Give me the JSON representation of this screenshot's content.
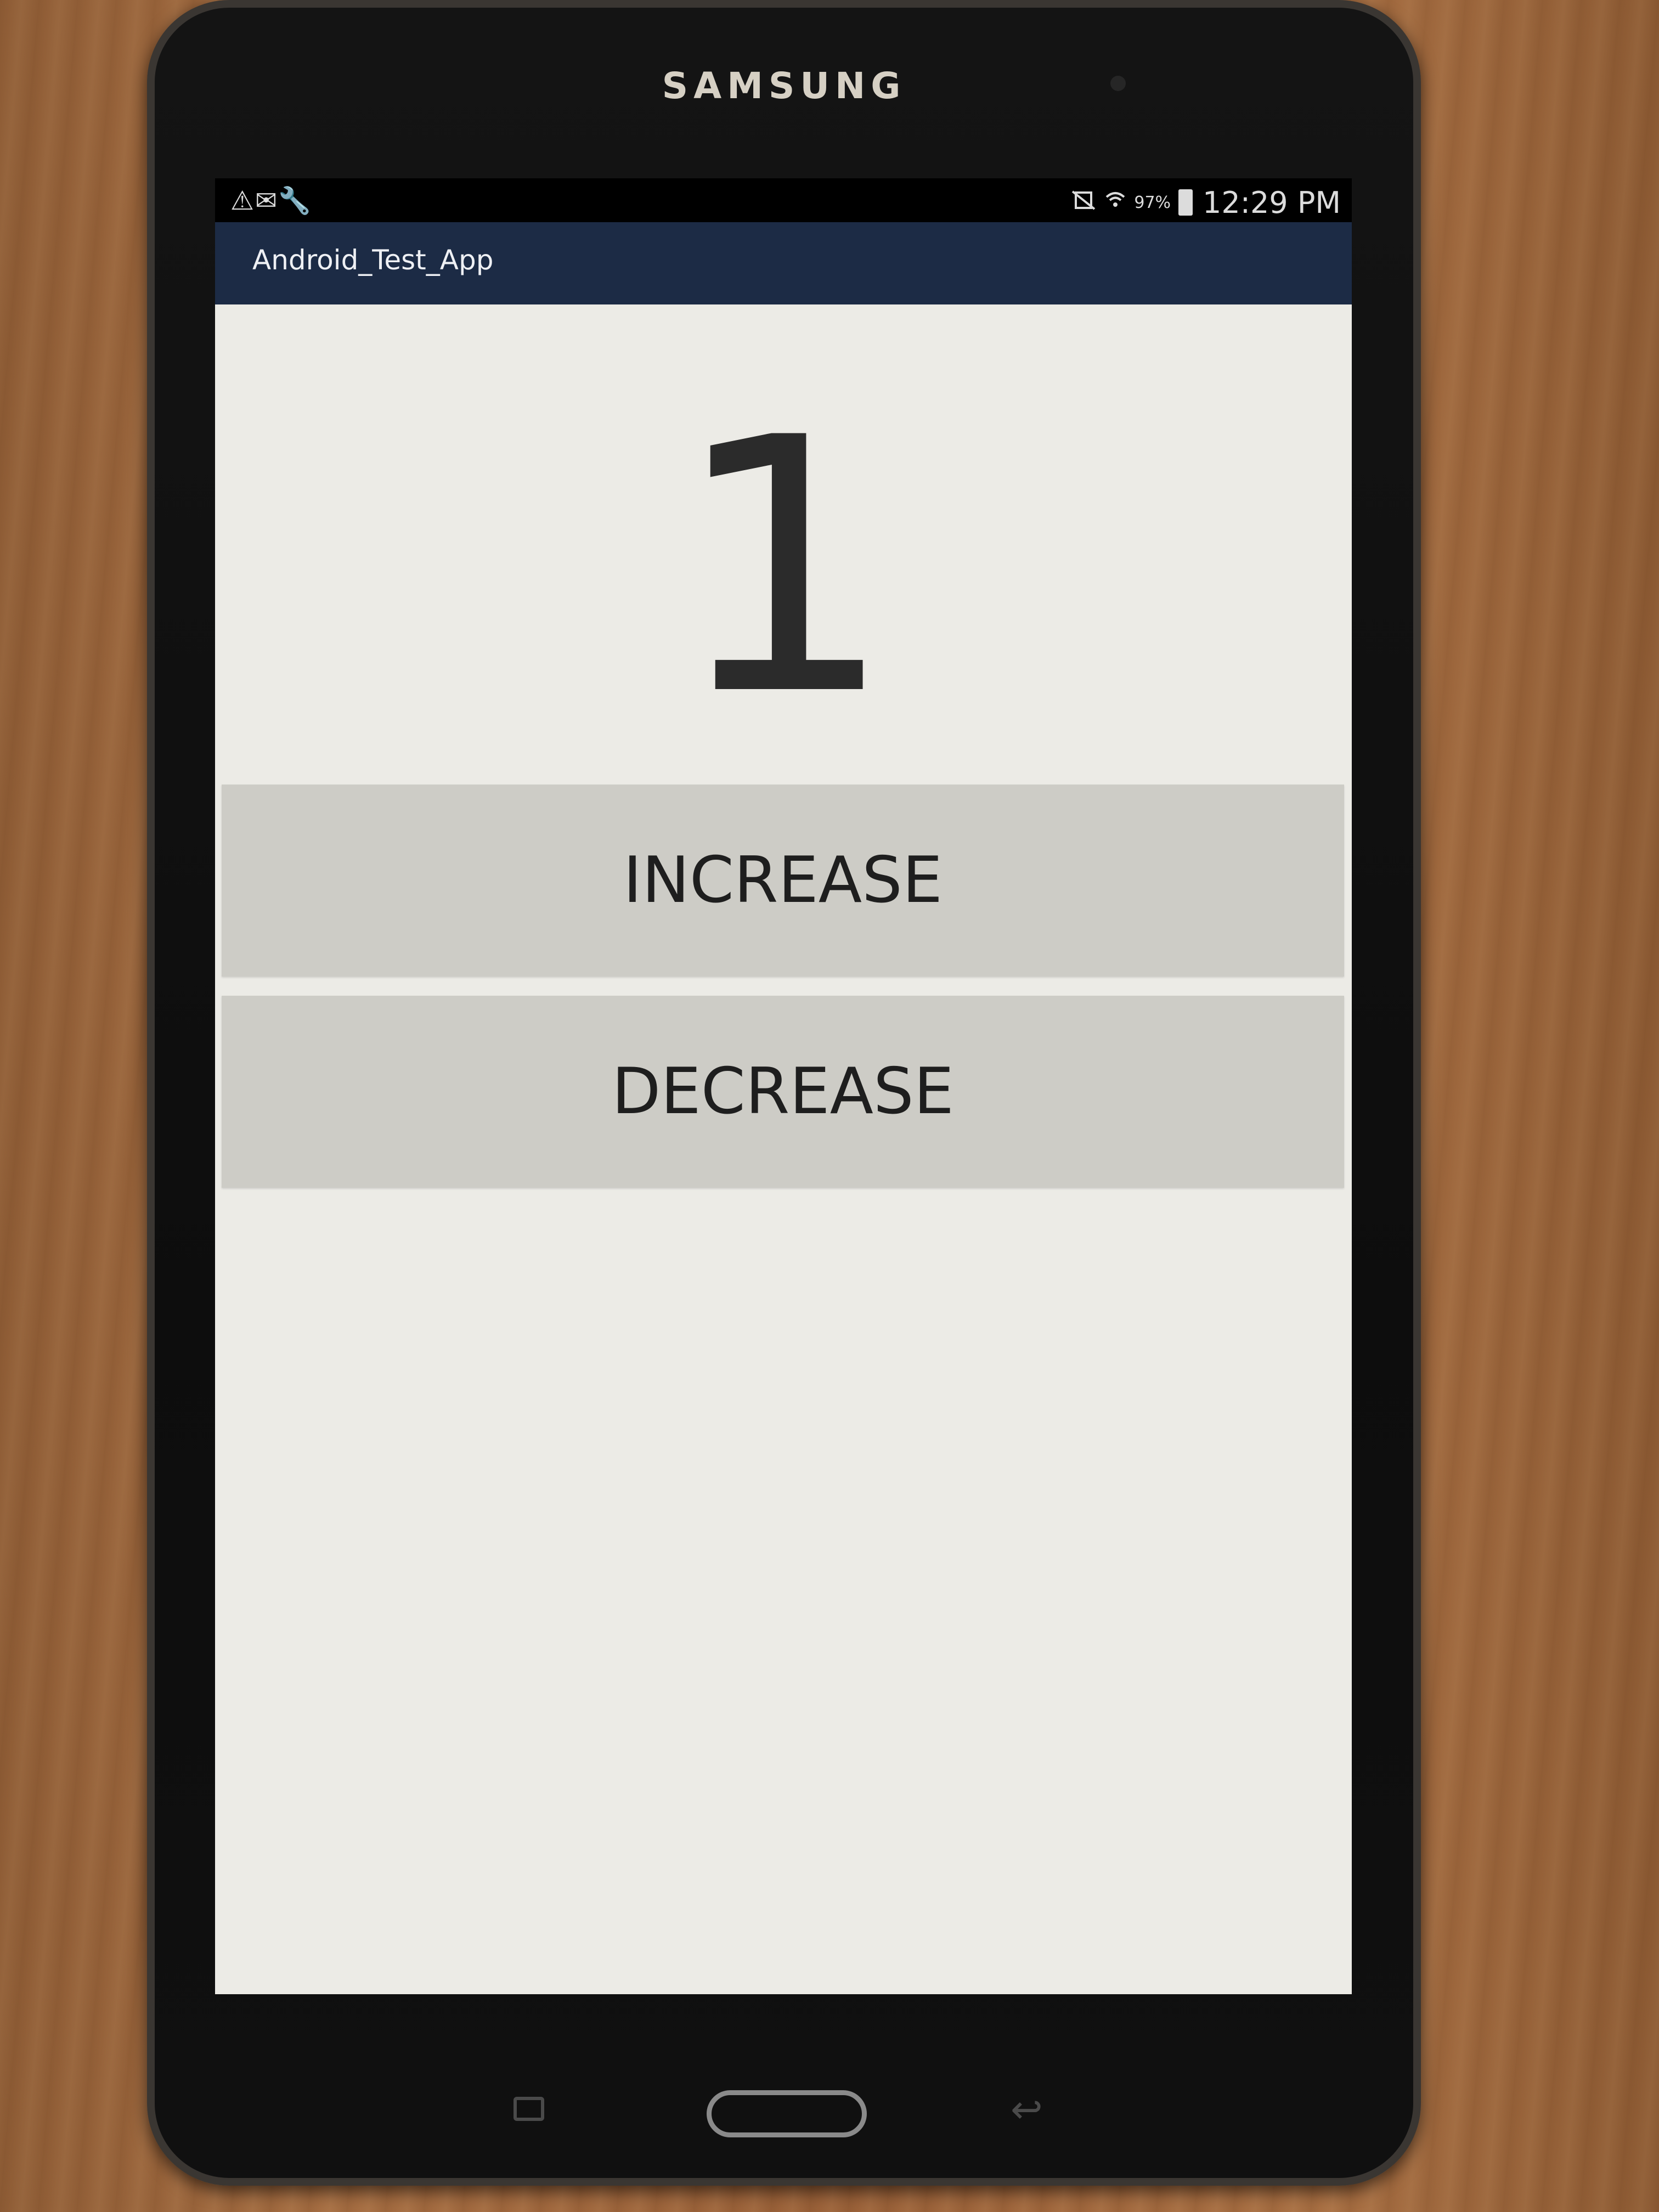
{
  "device": {
    "brand": "SAMSUNG"
  },
  "status_bar": {
    "notification_icons": "⚠✉🔧",
    "battery": "97%",
    "time": "12:29 PM",
    "icons": [
      "mute-icon",
      "wifi-icon",
      "battery-icon"
    ]
  },
  "app": {
    "title": "Android_Test_App"
  },
  "main": {
    "counter": "1",
    "increase_label": "INCREASE",
    "decrease_label": "DECREASE"
  },
  "nav": {
    "icons": [
      "recent-apps-icon",
      "home-button",
      "back-icon"
    ]
  },
  "colors": {
    "action_bar": "#1c2b45",
    "screen_background": "#ecebe6",
    "button_background": "#cdccc6"
  }
}
